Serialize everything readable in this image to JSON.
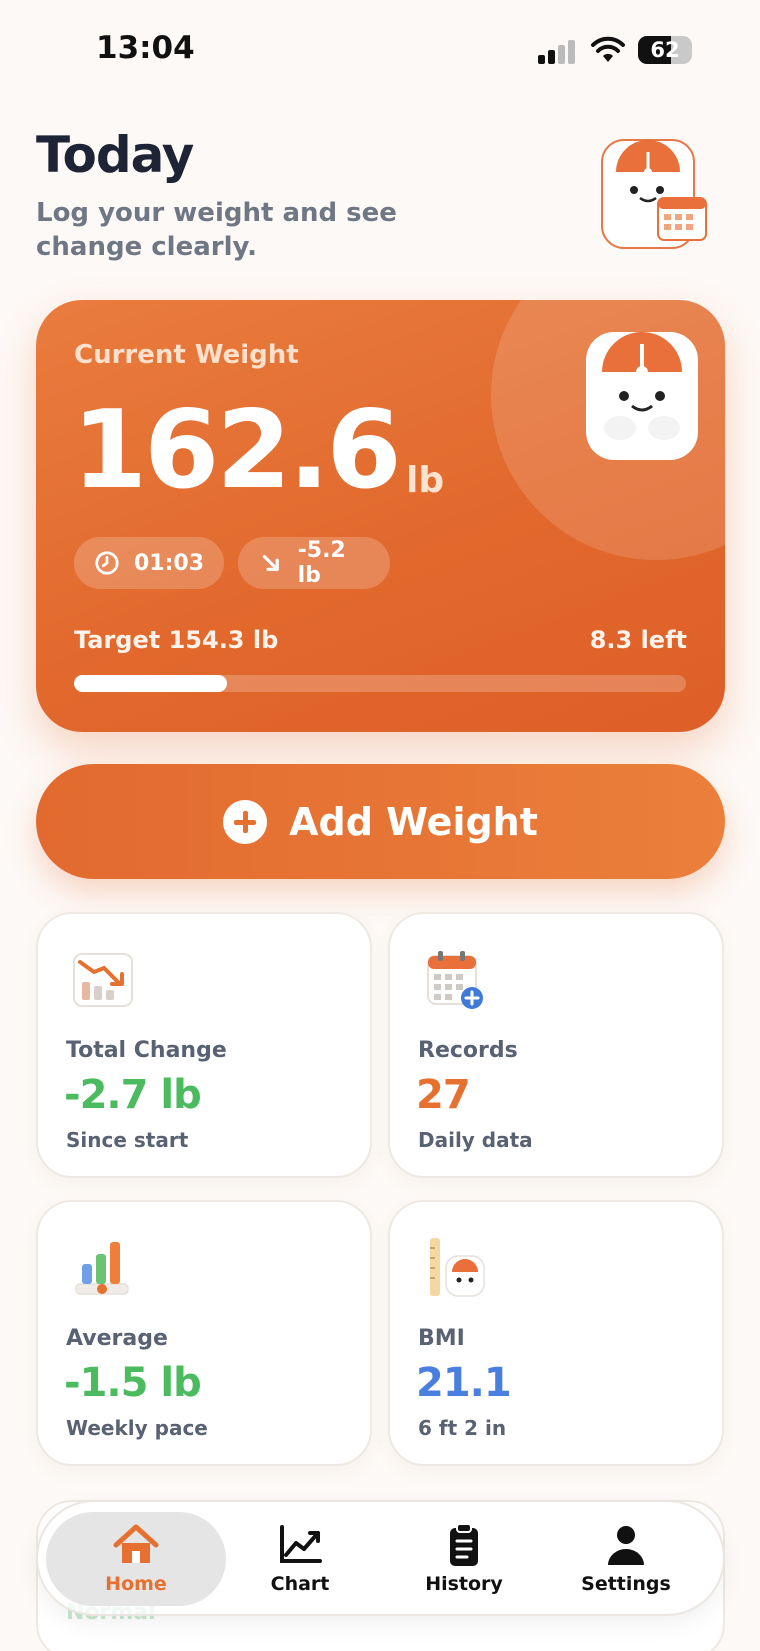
{
  "status_bar": {
    "time": "13:04",
    "battery": "62"
  },
  "header": {
    "title": "Today",
    "subtitle": "Log your weight and see change clearly."
  },
  "hero": {
    "label": "Current Weight",
    "weight_value": "162.6",
    "weight_unit": "lb",
    "time_chip": "01:03",
    "delta_chip": "-5.2 lb",
    "target_label": "Target 154.3 lb",
    "remaining_label": "8.3 left",
    "progress_fraction": 0.25
  },
  "add_button": {
    "label": "Add Weight"
  },
  "stats": {
    "total_change": {
      "title": "Total Change",
      "value": "-2.7 lb",
      "sub": "Since start"
    },
    "records": {
      "title": "Records",
      "value": "27",
      "sub": "Daily data"
    },
    "average": {
      "title": "Average",
      "value": "-1.5 lb",
      "sub": "Weekly pace"
    },
    "bmi": {
      "title": "BMI",
      "value": "21.1",
      "sub": "6 ft 2 in"
    }
  },
  "peek": {
    "label": "Normal"
  },
  "tab_bar": {
    "home": "Home",
    "chart": "Chart",
    "history": "History",
    "settings": "Settings"
  },
  "colors": {
    "accent": "#e5702f",
    "positive": "#4cbb5f",
    "bmi": "#4a7fe0",
    "text": "#1c2436",
    "muted": "#6f7684"
  }
}
